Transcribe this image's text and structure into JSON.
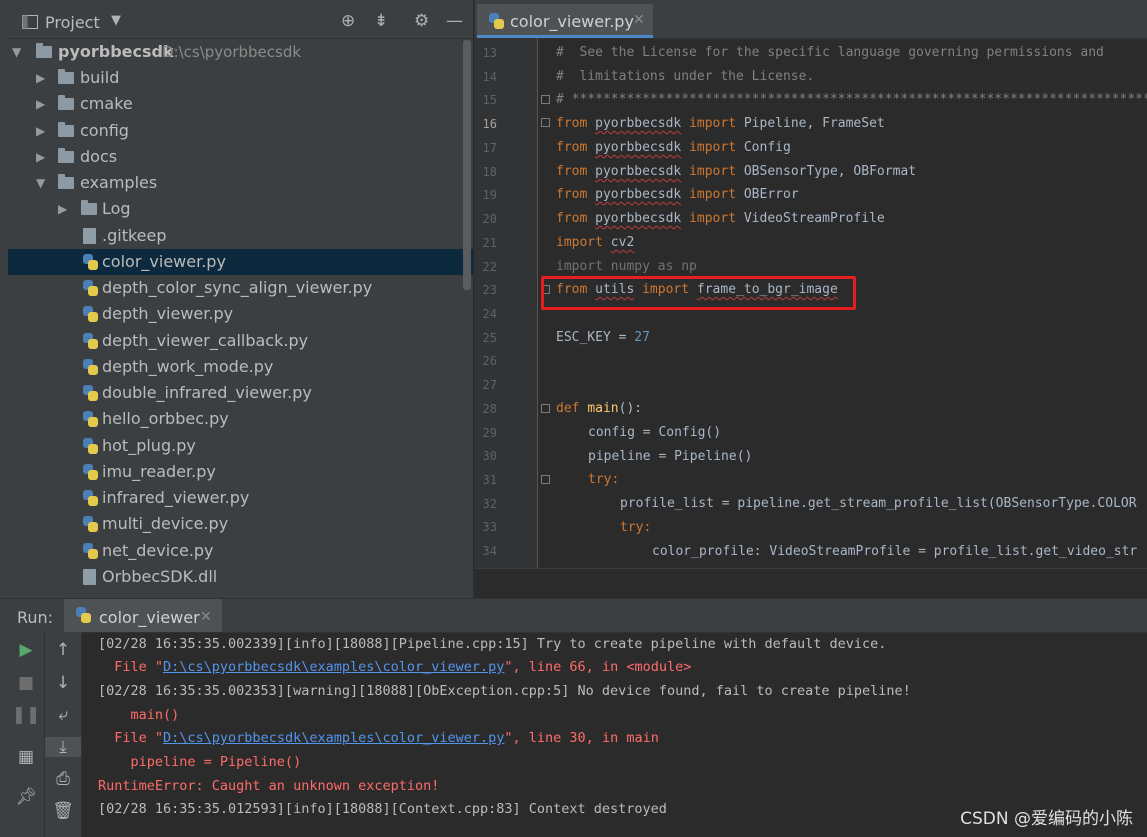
{
  "project": {
    "title": "Project",
    "root_name": "pyorbbecsdk",
    "root_path": "D:\\cs\\pyorbbecsdk",
    "folders": [
      "build",
      "cmake",
      "config",
      "docs"
    ],
    "examples_folder": "examples",
    "log_folder": "Log",
    "files": [
      ".gitkeep",
      "color_viewer.py",
      "depth_color_sync_align_viewer.py",
      "depth_viewer.py",
      "depth_viewer_callback.py",
      "depth_work_mode.py",
      "double_infrared_viewer.py",
      "hello_orbbec.py",
      "hot_plug.py",
      "imu_reader.py",
      "infrared_viewer.py",
      "multi_device.py",
      "net_device.py",
      "OrbbecSDK.dll"
    ],
    "selected_file": "color_viewer.py"
  },
  "editor": {
    "tab_label": "color_viewer.py",
    "line_numbers": [
      "13",
      "14",
      "15",
      "16",
      "17",
      "18",
      "19",
      "20",
      "21",
      "22",
      "23",
      "24",
      "25",
      "26",
      "27",
      "28",
      "29",
      "30",
      "31",
      "32",
      "33",
      "34"
    ],
    "lines": {
      "l13": "#  See the License for the specific language governing permissions and",
      "l14": "#  limitations under the License.",
      "l15": "# ****************************************************************************",
      "l16_from": "from",
      "l16_mod": "pyorbbecsdk",
      "l16_imp": "import",
      "l16_rest": "Pipeline, FrameSet",
      "l17_from": "from",
      "l17_mod": "pyorbbecsdk",
      "l17_imp": "import",
      "l17_rest": "Config",
      "l18_from": "from",
      "l18_mod": "pyorbbecsdk",
      "l18_imp": "import",
      "l18_rest": "OBSensorType, OBFormat",
      "l19_from": "from",
      "l19_mod": "pyorbbecsdk",
      "l19_imp": "import",
      "l19_rest": "OBError",
      "l20_from": "from",
      "l20_mod": "pyorbbecsdk",
      "l20_imp": "import",
      "l20_rest": "VideoStreamProfile",
      "l21_imp": "import",
      "l21_mod": "cv2",
      "l22": "import numpy as np",
      "l23_from": "from",
      "l23_mod": "utils",
      "l23_imp": "import",
      "l23_rest": "frame_to_bgr_image",
      "l25_name": "ESC_KEY = ",
      "l25_num": "27",
      "l28_def": "def",
      "l28_fn": "main",
      "l28_rest": "():",
      "l29": "config = Config()",
      "l30": "pipeline = Pipeline()",
      "l31_try": "try:",
      "l32": "profile_list = pipeline.get_stream_profile_list(OBSensorType.COLOR",
      "l33_try": "try:",
      "l34": "color_profile: VideoStreamProfile = profile_list.get_video_str"
    }
  },
  "run": {
    "label": "Run:",
    "tab_label": "color_viewer",
    "console": {
      "line1": "[02/28 16:35:35.002339][info][18088][Pipeline.cpp:15] Try to create pipeline with default device.",
      "line2_pre": "  File \"",
      "line2_link": "D:\\cs\\pyorbbecsdk\\examples\\color_viewer.py",
      "line2_post": "\", line 66, in <module>",
      "line3": "[02/28 16:35:35.002353][warning][18088][ObException.cpp:5] No device found, fail to create pipeline!",
      "line4": "    main()",
      "line5_pre": "  File \"",
      "line5_link": "D:\\cs\\pyorbbecsdk\\examples\\color_viewer.py",
      "line5_post": "\", line 30, in main",
      "line6": "    pipeline = Pipeline()",
      "line7": "RuntimeError: Caught an unknown exception!",
      "line8": "[02/28 16:35:35.012593][info][18088][Context.cpp:83] Context destroyed"
    }
  },
  "watermark": "CSDN @爱编码的小陈"
}
